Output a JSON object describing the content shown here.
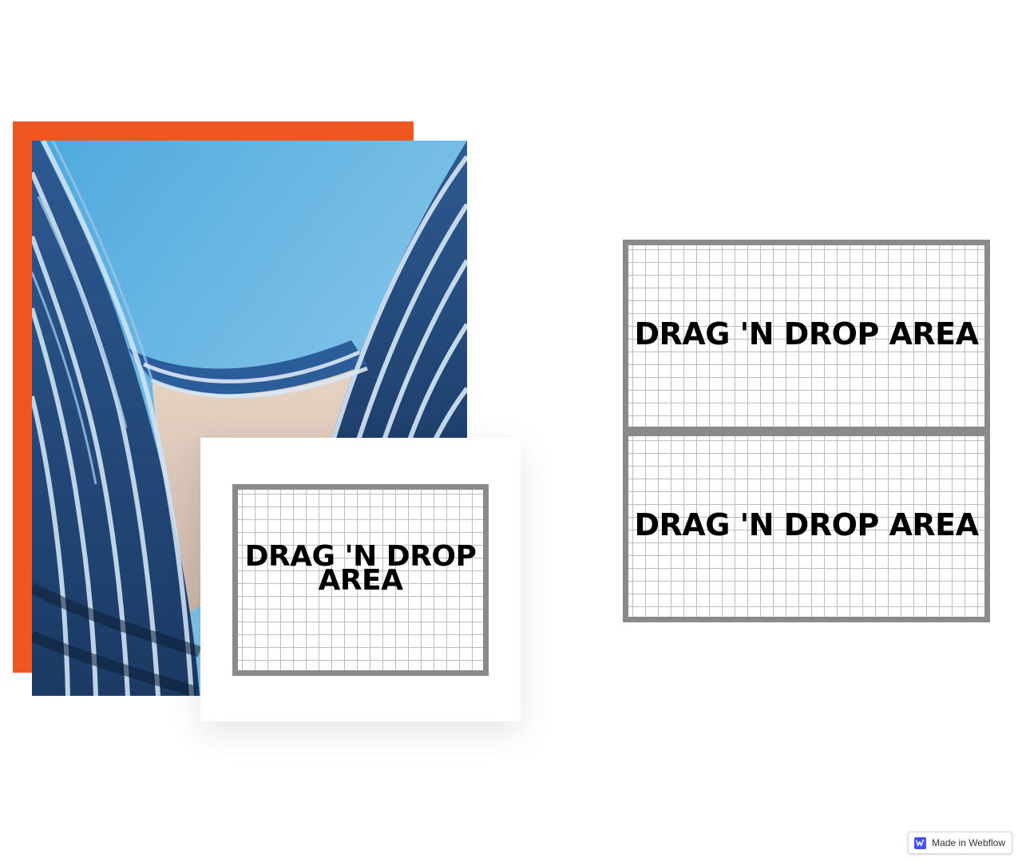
{
  "colors": {
    "accent": "#ee5722",
    "grid_border": "#8a8a8a",
    "grid_line": "#bdbdbd",
    "badge_logo": "#4353ff"
  },
  "hero": {
    "photo_icon": "architecture-photo"
  },
  "dropzones": {
    "card_label": "DRAG 'N DROP AREA",
    "right_top_label": "DRAG 'N DROP AREA",
    "right_bottom_label": "DRAG 'N DROP AREA"
  },
  "badge": {
    "icon": "webflow-logo-icon",
    "label": "Made in Webflow"
  }
}
